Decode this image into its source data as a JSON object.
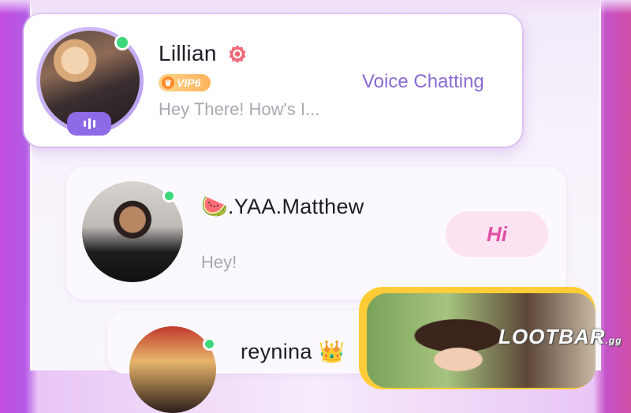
{
  "contacts": [
    {
      "name": "Lillian",
      "vip_label": "VIP6",
      "message": "Hey There! How's I...",
      "status": "Voice Chatting",
      "online": true
    },
    {
      "name_emoji": "🍉",
      "name": ".YAA.Matthew",
      "message": "Hey!",
      "action_label": "Hi",
      "online": true
    },
    {
      "name": "reynina",
      "name_emoji": "👑",
      "online": true
    }
  ],
  "watermark": {
    "text": "LOOTBAR",
    "suffix": ".gg"
  },
  "colors": {
    "accent_purple": "#8a6ad4",
    "online_green": "#3dd67b",
    "hi_pink": "#e04fa7",
    "vip_orange": "#ffb35c"
  },
  "icons": {
    "verified": "verified-badge-icon",
    "voice": "voice-bars-icon",
    "vip": "vip-crown-icon"
  }
}
